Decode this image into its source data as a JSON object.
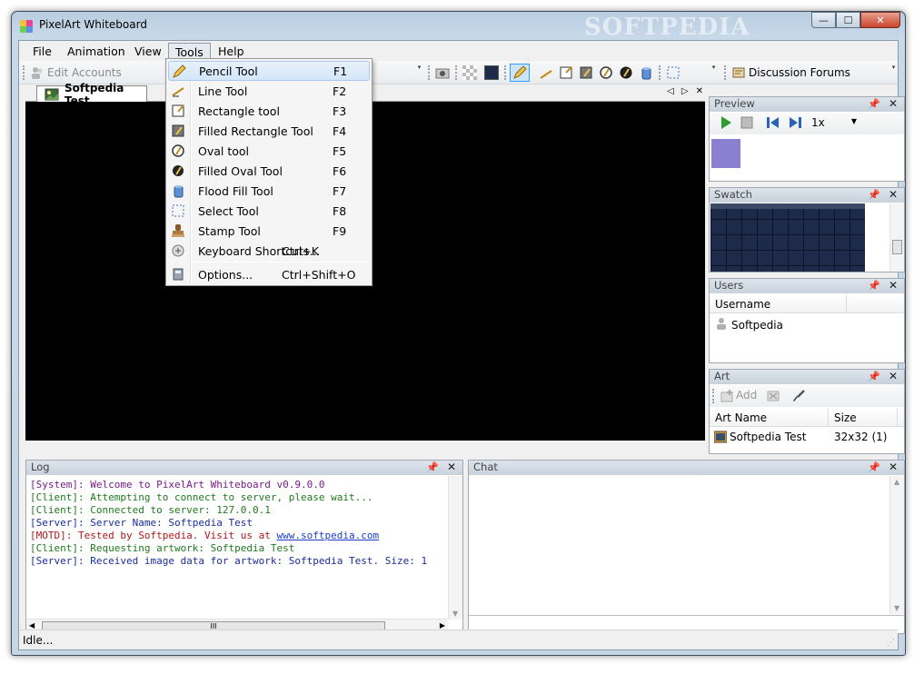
{
  "window": {
    "title": "PixelArt Whiteboard",
    "watermark": "SOFTPEDIA",
    "caption_min": "—",
    "caption_max": "☐",
    "caption_close": "✕"
  },
  "menubar": {
    "items": [
      {
        "label": "File"
      },
      {
        "label": "Animation"
      },
      {
        "label": "View"
      },
      {
        "label": "Tools"
      },
      {
        "label": "Help"
      }
    ]
  },
  "toolbar": {
    "edit_accounts_label": "Edit Accounts",
    "discussion_forums_label": "Discussion Forums",
    "overflow_glyph": "▾"
  },
  "document": {
    "tab_label": "Softpedia Test",
    "nav_prev": "◁",
    "nav_next": "▷",
    "close": "✕"
  },
  "preview_panel": {
    "title": "Preview",
    "speed_value": "1x",
    "preview_color": "#8a7fd0"
  },
  "swatch_panel": {
    "title": "Swatch"
  },
  "users_panel": {
    "title": "Users",
    "column_username": "Username",
    "users": [
      "Softpedia"
    ]
  },
  "art_panel": {
    "title": "Art",
    "add_label": "Add",
    "column_name": "Art Name",
    "column_size": "Size",
    "rows": [
      {
        "name": "Softpedia Test",
        "size": "32x32 (1)"
      }
    ]
  },
  "log_panel": {
    "title": "Log",
    "lines": [
      {
        "text": "[System]: Welcome to PixelArt Whiteboard v0.9.0.0",
        "color": "#7a1a8c"
      },
      {
        "text": "[Client]: Attempting to connect to server, please wait...",
        "color": "#1f7a1f"
      },
      {
        "text": "[Client]: Connected to server: 127.0.0.1",
        "color": "#1f7a1f"
      },
      {
        "text": "[Server]: Server Name: Softpedia Test",
        "color": "#1a2ca0"
      },
      {
        "text": "[MOTD]: Tested by Softpedia. Visit us at ",
        "link": "www.softpedia.com",
        "color": "#b01818"
      },
      {
        "text": "[Client]: Requesting artwork: Softpedia Test",
        "color": "#1f7a1f"
      },
      {
        "text": "[Server]: Received image data for artwork: Softpedia Test. Size: 1",
        "color": "#1a2ca0"
      }
    ],
    "hscroll_thumb": "III"
  },
  "chat_panel": {
    "title": "Chat"
  },
  "status": {
    "text": "Idle..."
  },
  "tools_menu": {
    "items": [
      {
        "label": "Pencil Tool",
        "shortcut": "F1",
        "icon": "pencil-icon"
      },
      {
        "label": "Line Tool",
        "shortcut": "F2",
        "icon": "line-icon"
      },
      {
        "label": "Rectangle tool",
        "shortcut": "F3",
        "icon": "rectangle-icon"
      },
      {
        "label": "Filled Rectangle Tool",
        "shortcut": "F4",
        "icon": "filled-rectangle-icon"
      },
      {
        "label": "Oval tool",
        "shortcut": "F5",
        "icon": "oval-icon"
      },
      {
        "label": "Filled Oval Tool",
        "shortcut": "F6",
        "icon": "filled-oval-icon"
      },
      {
        "label": "Flood Fill Tool",
        "shortcut": "F7",
        "icon": "flood-fill-icon"
      },
      {
        "label": "Select Tool",
        "shortcut": "F8",
        "icon": "select-icon"
      },
      {
        "label": "Stamp Tool",
        "shortcut": "F9",
        "icon": "stamp-icon"
      },
      {
        "label": "Keyboard Shortcuts...",
        "shortcut": "Ctrl+K",
        "icon": "keyboard-icon"
      },
      {
        "label": "Options...",
        "shortcut": "Ctrl+Shift+O",
        "icon": "options-icon"
      }
    ]
  }
}
